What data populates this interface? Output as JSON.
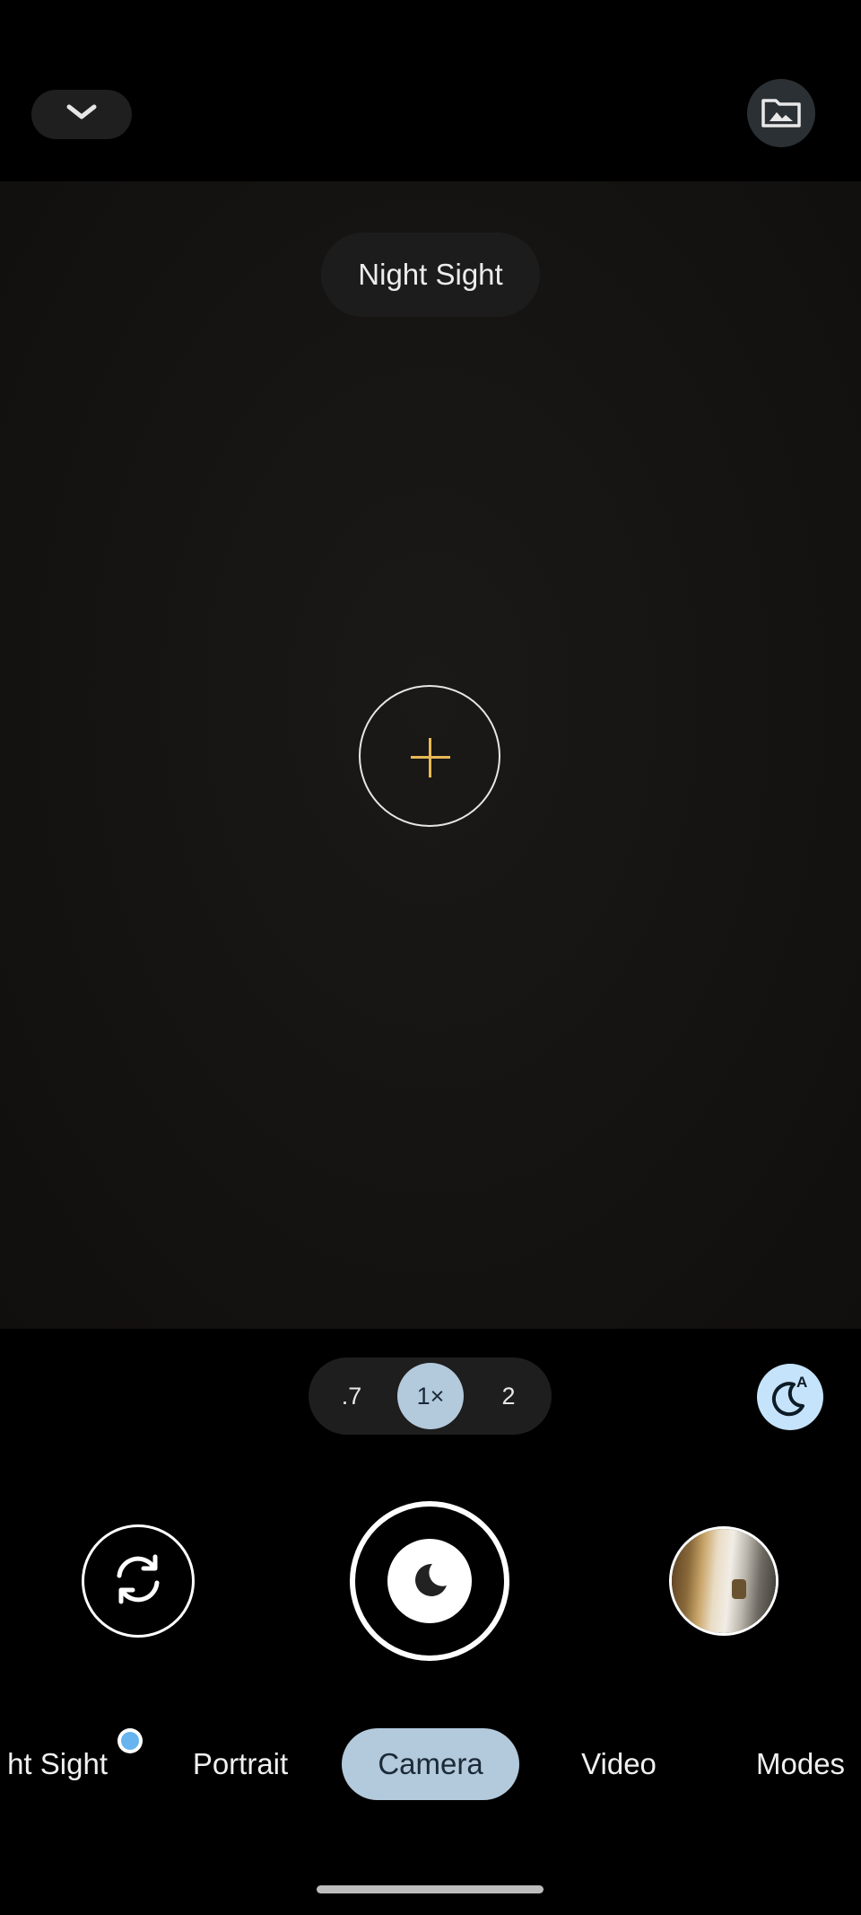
{
  "top_bar": {
    "collapse_icon": "chevron-down-icon",
    "gallery_icon": "photo-folder-icon"
  },
  "viewfinder": {
    "mode_chip_label": "Night Sight",
    "focus_icon": "focus-crosshair-icon",
    "focus_color": "#e8b857"
  },
  "zoom": {
    "options": [
      ".7",
      "1×",
      "2"
    ],
    "selected": "1×"
  },
  "controls": {
    "night_auto_icon": "moon-auto-icon",
    "flip_icon": "switch-camera-icon",
    "shutter_icon": "moon-icon",
    "thumbnail": "last-photo-thumbnail"
  },
  "modes": {
    "items": [
      "ht Sight",
      "Portrait",
      "Camera",
      "Video",
      "Modes"
    ],
    "selected": "Camera"
  },
  "colors": {
    "accent": "#b3c9dc",
    "night_auto_bg": "#c5e3fa",
    "new_dot": "#67b4ee"
  }
}
